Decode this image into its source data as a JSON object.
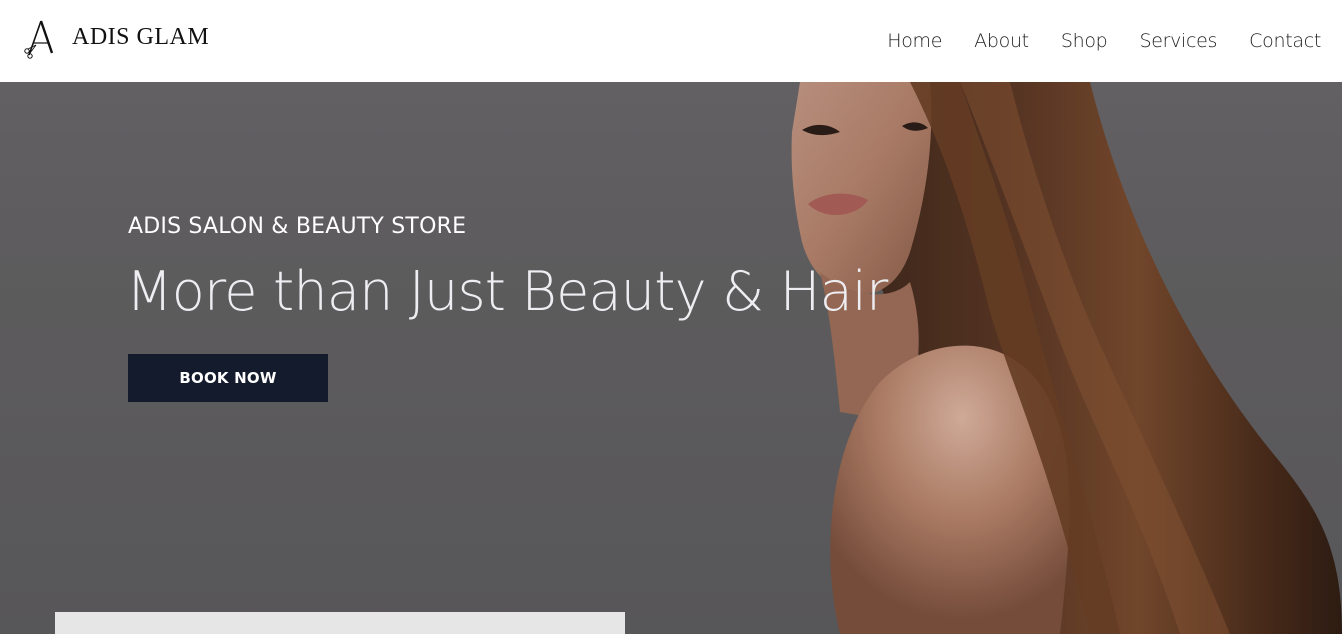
{
  "brand": {
    "name": "ADIS GLAM",
    "logo_icon": "letter-a-scissors-logo"
  },
  "nav": {
    "items": [
      {
        "label": "Home"
      },
      {
        "label": "About"
      },
      {
        "label": "Shop"
      },
      {
        "label": "Services"
      },
      {
        "label": "Contact"
      }
    ]
  },
  "hero": {
    "eyebrow": "ADIS SALON & BEAUTY STORE",
    "title": "More than Just Beauty & Hair",
    "cta_label": "BOOK NOW",
    "image": "woman-long-straight-hair-photo"
  },
  "colors": {
    "hero_background": "#656365",
    "button_background": "#141b2d",
    "header_background": "#ffffff",
    "card_background": "#e6e6e6"
  }
}
